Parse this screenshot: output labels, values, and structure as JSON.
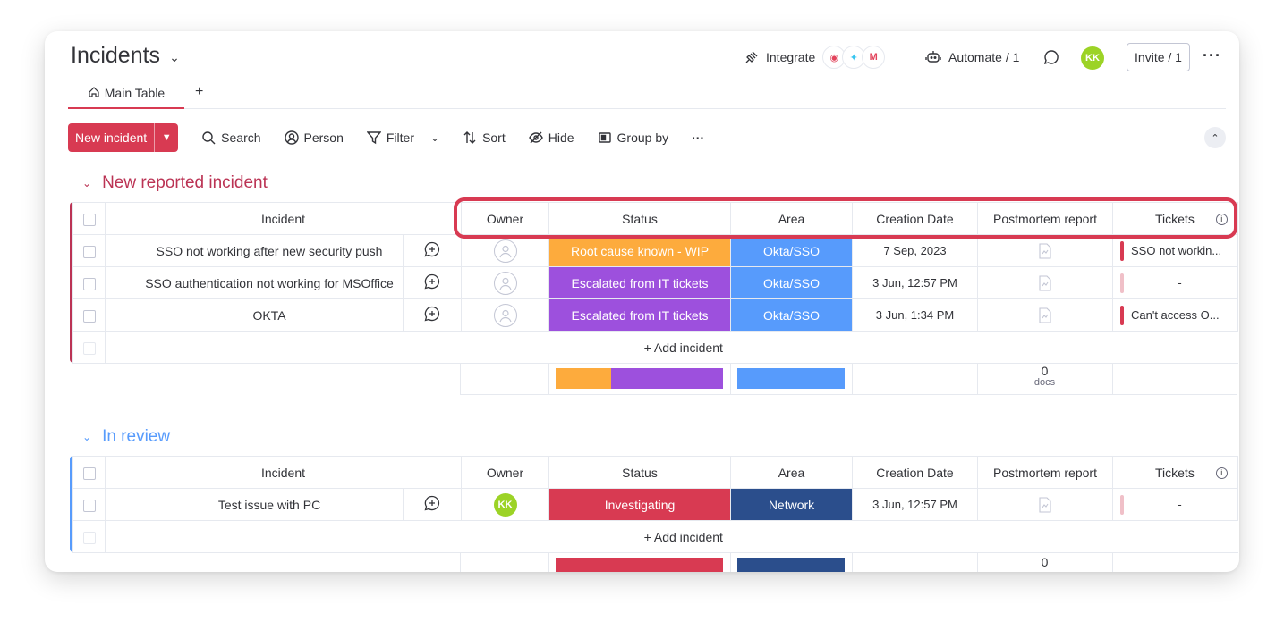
{
  "header": {
    "title": "Incidents",
    "integrate_label": "Integrate",
    "automate_label": "Automate / 1",
    "avatar_initials": "KK",
    "invite_label": "Invite / 1"
  },
  "tabs": [
    {
      "label": "Main Table"
    }
  ],
  "toolbar": {
    "new_item_label": "New incident",
    "search_label": "Search",
    "person_label": "Person",
    "filter_label": "Filter",
    "sort_label": "Sort",
    "hide_label": "Hide",
    "group_by_label": "Group by"
  },
  "columns": {
    "item": "Incident",
    "owner": "Owner",
    "status": "Status",
    "area": "Area",
    "creation_date": "Creation Date",
    "postmortem": "Postmortem report",
    "tickets": "Tickets"
  },
  "add_item_label": "+ Add incident",
  "groups": [
    {
      "title": "New reported incident",
      "color": "#bb3354",
      "rows": [
        {
          "name": "SSO not working after new security push",
          "status": "Root cause known - WIP",
          "status_color": "#fdab3d",
          "area": "Okta/SSO",
          "area_color": "#579bfc",
          "date": "7 Sep, 2023",
          "ticket": "SSO not workin..."
        },
        {
          "name": "SSO authentication not working for MSOffice",
          "status": "Escalated from IT tickets",
          "status_color": "#9d50dd",
          "area": "Okta/SSO",
          "area_color": "#579bfc",
          "date": "3 Jun, 12:57 PM",
          "ticket": "-"
        },
        {
          "name": "OKTA",
          "status": "Escalated from IT tickets",
          "status_color": "#9d50dd",
          "area": "Okta/SSO",
          "area_color": "#579bfc",
          "date": "3 Jun, 1:34 PM",
          "ticket": "Can't access O..."
        }
      ],
      "summary": {
        "docs_count": "0",
        "docs_label": "docs"
      }
    },
    {
      "title": "In review",
      "color": "#579bfc",
      "rows": [
        {
          "name": "Test issue with PC",
          "owner": "KK",
          "status": "Investigating",
          "status_color": "#d83a52",
          "area": "Network",
          "area_color": "#2b4e8c",
          "date": "3 Jun, 12:57 PM",
          "ticket": "-"
        }
      ],
      "summary": {
        "docs_count": "0"
      }
    }
  ]
}
